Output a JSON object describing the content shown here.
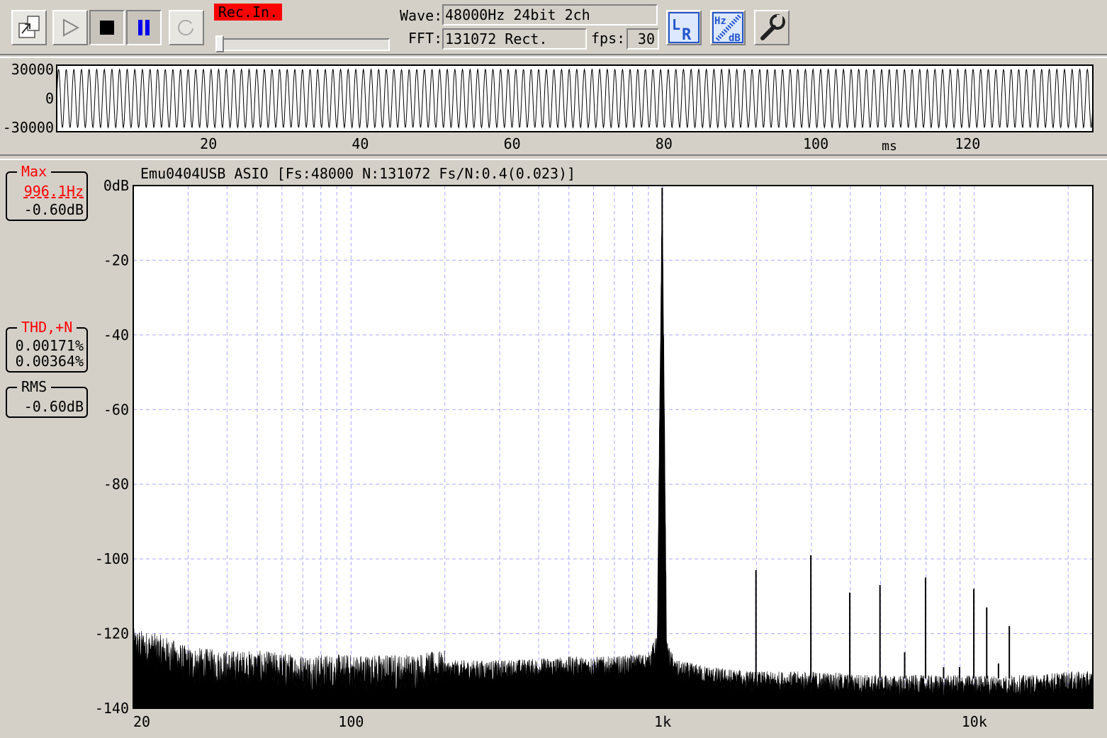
{
  "toolbar": {
    "buttons": [
      "export",
      "play",
      "stop",
      "pause",
      "repeat"
    ],
    "rec_input_label": "Rec.In.",
    "input_level_percent": 0,
    "wave_label": "Wave:",
    "wave_value": "48000Hz 24bit 2ch",
    "fft_label": "FFT:",
    "fft_value": "131072 Rect.",
    "fps_label": "fps:",
    "fps_value": "30",
    "lr_icon_text": "LR",
    "hz_icon_text": "Hz",
    "db_icon_text": "dB"
  },
  "waveform": {
    "y_ticks": [
      "30000",
      "0",
      "-30000"
    ],
    "x_ticks": [
      "20",
      "40",
      "60",
      "80",
      "100",
      "120"
    ],
    "x_tick_values": [
      20,
      40,
      60,
      80,
      100,
      120
    ],
    "x_unit": "ms",
    "x_range_ms": [
      0,
      136.5
    ],
    "signal_frequency_hz": 996.1,
    "amplitude": 30000
  },
  "spectrum": {
    "header": "Emu0404USB ASIO   [Fs:48000  N:131072  Fs/N:0.4(0.023)]",
    "y_ticks": [
      "0dB",
      "-20",
      "-40",
      "-60",
      "-80",
      "-100",
      "-120",
      "-140"
    ],
    "x_ticks": [
      "20",
      "100",
      "1k",
      "10k"
    ],
    "max_title": "Max",
    "max_freq": "996.1Hz",
    "max_level": "-0.60dB",
    "thd_title": "THD,+N",
    "thd_value": "0.00171%",
    "thdn_value": "0.00364%",
    "rms_title": "RMS",
    "rms_value": "-0.60dB"
  },
  "chart_data": {
    "type": "line",
    "title": "",
    "xlabel": "",
    "ylabel": "",
    "x_scale": "log",
    "xlim": [
      20,
      24000
    ],
    "ylim": [
      -140,
      0
    ],
    "grid": true,
    "series": [
      {
        "values_description_only_in_markup": false,
        "x": [
          20,
          25,
          30,
          40,
          50,
          70,
          100,
          150,
          200,
          300,
          500,
          700,
          900,
          960,
          996.1,
          1030,
          1100,
          1500,
          2000,
          3000,
          5000,
          7000,
          10000,
          15000,
          20000,
          24000
        ],
        "y": [
          -125,
          -127,
          -130,
          -131,
          -131,
          -132,
          -132,
          -132,
          -131,
          -131,
          -130,
          -130,
          -129,
          -124,
          -0.6,
          -126,
          -131,
          -133,
          -134,
          -134,
          -135,
          -135,
          -135,
          -135,
          -134,
          -134
        ]
      }
    ],
    "harmonics": {
      "x": [
        1992,
        2988,
        3984,
        4980,
        5976,
        6973,
        7969,
        8965,
        9961,
        10957,
        11953,
        12949
      ],
      "y": [
        -103,
        -99,
        -109,
        -107,
        -125,
        -105,
        -129,
        -129,
        -108,
        -113,
        -128,
        -118
      ]
    }
  }
}
